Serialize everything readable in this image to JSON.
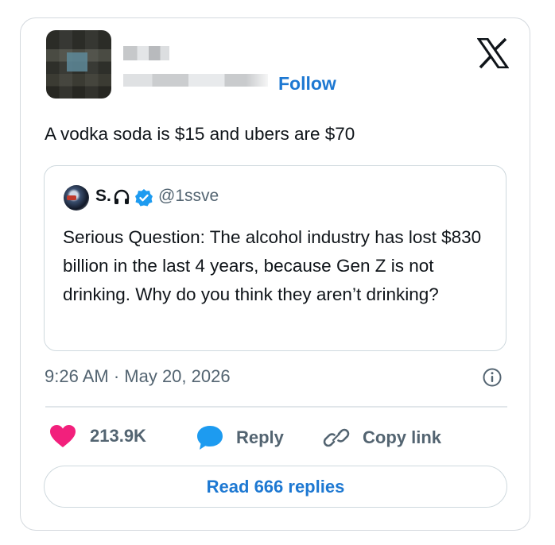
{
  "author": {
    "follow_label": "Follow"
  },
  "tweet": {
    "text": "A vodka soda is $15 and ubers are $70",
    "timestamp": "9:26 AM · May 20, 2026"
  },
  "quoted": {
    "name": "S.",
    "handle": "@1ssve",
    "text": "Serious Question: The alcohol industry has lost $830 billion in the last 4 years, because Gen Z is not drinking. Why do you think they aren’t drinking?"
  },
  "actions": {
    "likes_count": "213.9K",
    "reply_label": "Reply",
    "copy_link_label": "Copy link"
  },
  "read_replies_label": "Read 666 replies",
  "colors": {
    "accent": "#1d78d2",
    "heart": "#f2207c",
    "muted": "#536471"
  },
  "icons": [
    "x-logo-icon",
    "headphones-icon",
    "verified-badge-icon",
    "info-icon",
    "heart-icon",
    "reply-bubble-icon",
    "link-icon"
  ]
}
